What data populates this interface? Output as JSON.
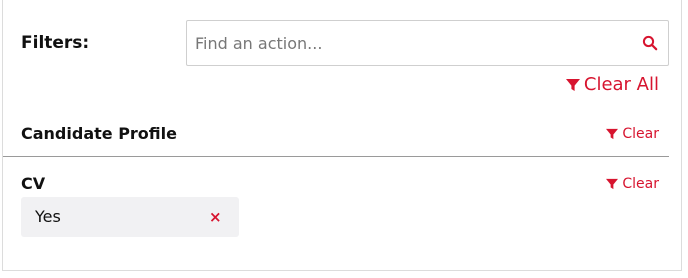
{
  "filters": {
    "label": "Filters:",
    "search_placeholder": "Find an action...",
    "search_value": "",
    "search_icon": "search-icon",
    "clear_all_label": "Clear All"
  },
  "sections": [
    {
      "title": "Candidate Profile",
      "clear_label": "Clear"
    },
    {
      "title": "CV",
      "clear_label": "Clear",
      "chips": [
        {
          "label": "Yes",
          "remove_glyph": "×"
        }
      ]
    }
  ],
  "colors": {
    "accent": "#d7142f",
    "chip_bg": "#f1f1f3",
    "divider": "#9a9a9a"
  }
}
